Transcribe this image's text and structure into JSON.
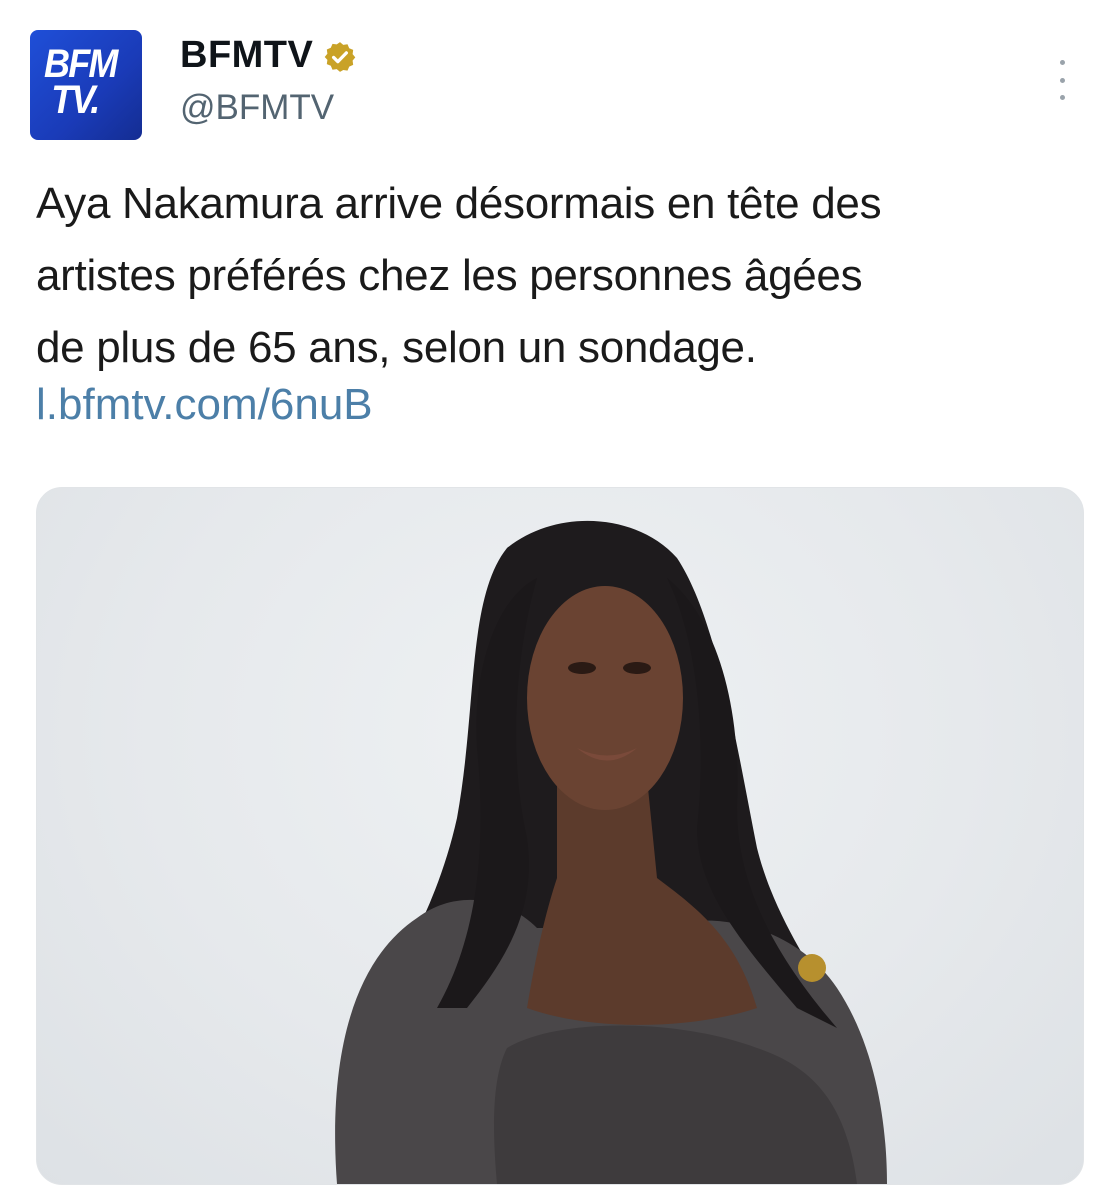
{
  "account": {
    "avatar_text_line1": "BFM",
    "avatar_text_line2": "TV.",
    "display_name": "BFMTV",
    "handle": "@BFMTV",
    "verified_badge_color": "#c9a227"
  },
  "tweet": {
    "text_lines": [
      "Aya Nakamura arrive désormais en tête des",
      "artistes préférés chez les personnes âgées",
      "de plus de 65 ans, selon un sondage."
    ],
    "link": "l.bfmtv.com/6nuB"
  },
  "colors": {
    "link": "#4c7fa8",
    "brand_blue": "#1f4fd8",
    "handle_gray": "#536471"
  },
  "icons": {
    "menu": "more-vertical-icon",
    "verified": "verified-badge-icon"
  }
}
